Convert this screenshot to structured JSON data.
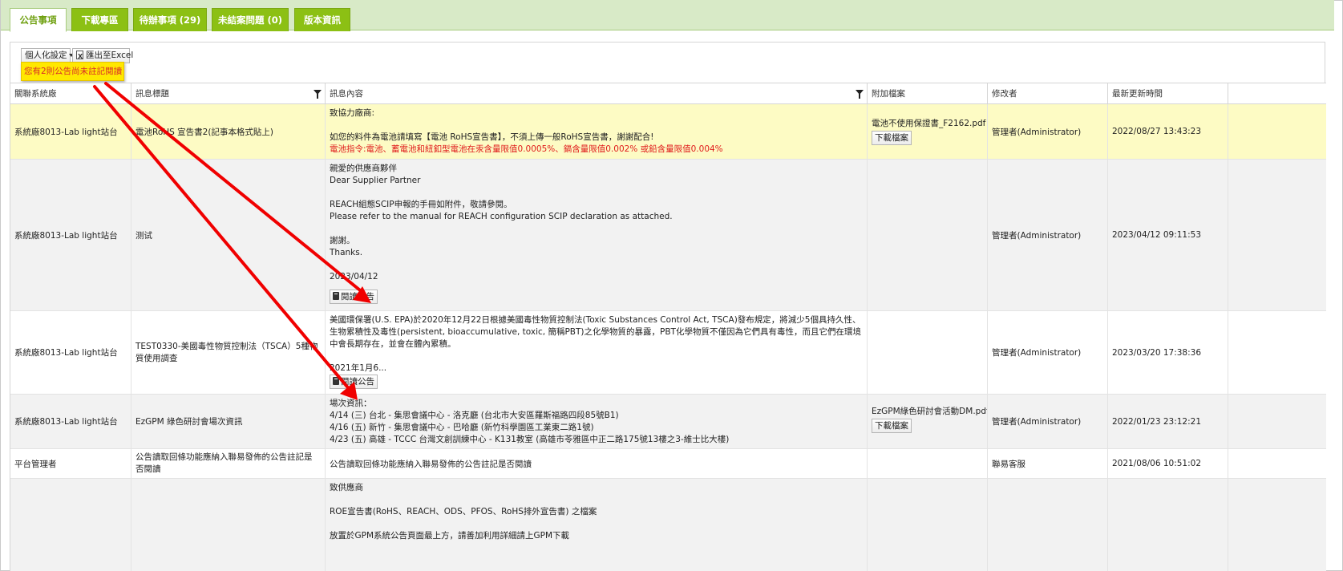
{
  "tabs": [
    {
      "label": "公告事項",
      "active": true
    },
    {
      "label": "下載專區",
      "active": false
    },
    {
      "label": "待辦事項 (29)",
      "active": false
    },
    {
      "label": "未結案問題 (0)",
      "active": false
    },
    {
      "label": "版本資訊",
      "active": false
    }
  ],
  "toolbar": {
    "personalize_label": "個人化設定",
    "export_label": "匯出至Excel"
  },
  "notice": "您有2則公告尚未註記閱讀",
  "columns": [
    "關聯系統廠",
    "訊息標題",
    "訊息內容",
    "附加檔案",
    "修改者",
    "最新更新時間"
  ],
  "rows": [
    {
      "vendor": "系統廠8013-Lab light站台",
      "title": "電池RoHS 宣告書2(記事本格式貼上)",
      "content": [
        "致協力廠商:",
        "",
        "如您的料件為電池請填寫【電池 RoHS宣告書】，不須上傳一般RoHS宣告書，謝謝配合!"
      ],
      "content_red": "電池指令:電池、蓄電池和紐釦型電池在汞含量限值0.0005%、鎘含量限值0.002% 或鉛含量限值0.004%",
      "attachment": "電池不使用保證書_F2162.pdf",
      "download_label": "下載檔案",
      "modifier": "管理者(Administrator)",
      "updated": "2022/08/27 13:43:23"
    },
    {
      "vendor": "系統廠8013-Lab light站台",
      "title": "测试",
      "content": [
        "親愛的供應商夥伴",
        "Dear Supplier Partner",
        "",
        "REACH組態SCIP申報的手冊如附件，敬請參閱。",
        "Please refer to the manual for REACH configuration SCIP declaration as attached.",
        "",
        "謝謝。",
        "Thanks.",
        "",
        "2023/04/12"
      ],
      "read_label": "閱讀公告",
      "modifier": "管理者(Administrator)",
      "updated": "2023/04/12 09:11:53"
    },
    {
      "vendor": "系統廠8013-Lab light站台",
      "title": "TEST0330-美國毒性物質控制法（TSCA）5種物質使用調查",
      "content_para": "美國環保署(U.S. EPA)於2020年12月22日根據美國毒性物質控制法(Toxic Substances Control Act, TSCA)發布規定，將減少5個具持久性、生物累積性及毒性(persistent, bioaccumulative, toxic, 簡稱PBT)之化學物質的暴露，PBT化學物質不僅因為它們具有毒性，而且它們在環境中會長期存在，並會在體內累積。",
      "content_date": "2021年1月6...",
      "read_label": "閱讀公告",
      "modifier": "管理者(Administrator)",
      "updated": "2023/03/20 17:38:36"
    },
    {
      "vendor": "系統廠8013-Lab light站台",
      "title": "EzGPM 綠色研討會場次資訊",
      "content": [
        "場次資訊：",
        "4/14 (三) 台北 - 集思會議中心 - 洛克廳 (台北市大安區羅斯福路四段85號B1)",
        "4/16 (五) 新竹 - 集思會議中心 - 巴哈廳 (新竹科學園區工業東二路1號)",
        "4/23 (五) 高雄 - TCCC 台灣文創訓練中心 - K131教室 (高雄市苓雅區中正二路175號13樓之3-維士比大樓)"
      ],
      "attachment": "EzGPM綠色研討會活動DM.pdf",
      "download_label": "下載檔案",
      "modifier": "管理者(Administrator)",
      "updated": "2022/01/23 23:12:21"
    },
    {
      "vendor": "平台管理者",
      "title": "公告讀取回條功能應納入聯易發佈的公告註記是否閱讀",
      "content": [
        "公告讀取回條功能應納入聯易發佈的公告註記是否閱讀"
      ],
      "modifier": "聯易客服",
      "updated": "2021/08/06 10:51:02"
    },
    {
      "vendor": "",
      "title": "",
      "content": [
        "致供應商",
        "",
        "ROE宣告書(RoHS、REACH、ODS、PFOS、RoHS排外宣告書) 之檔案",
        "",
        "放置於GPM系統公告頁面最上方，請善加利用詳細請上GPM下載"
      ],
      "modifier": "",
      "updated": ""
    }
  ],
  "colors": {
    "tab_green": "#8cc014",
    "tab_bar_bg": "#d8eac7",
    "row_highlight": "#fdfbc4",
    "row_alt": "#f2f2f2",
    "notice_bg": "#ffe800",
    "notice_text": "#d92a2a",
    "arrow": "#f00000"
  }
}
